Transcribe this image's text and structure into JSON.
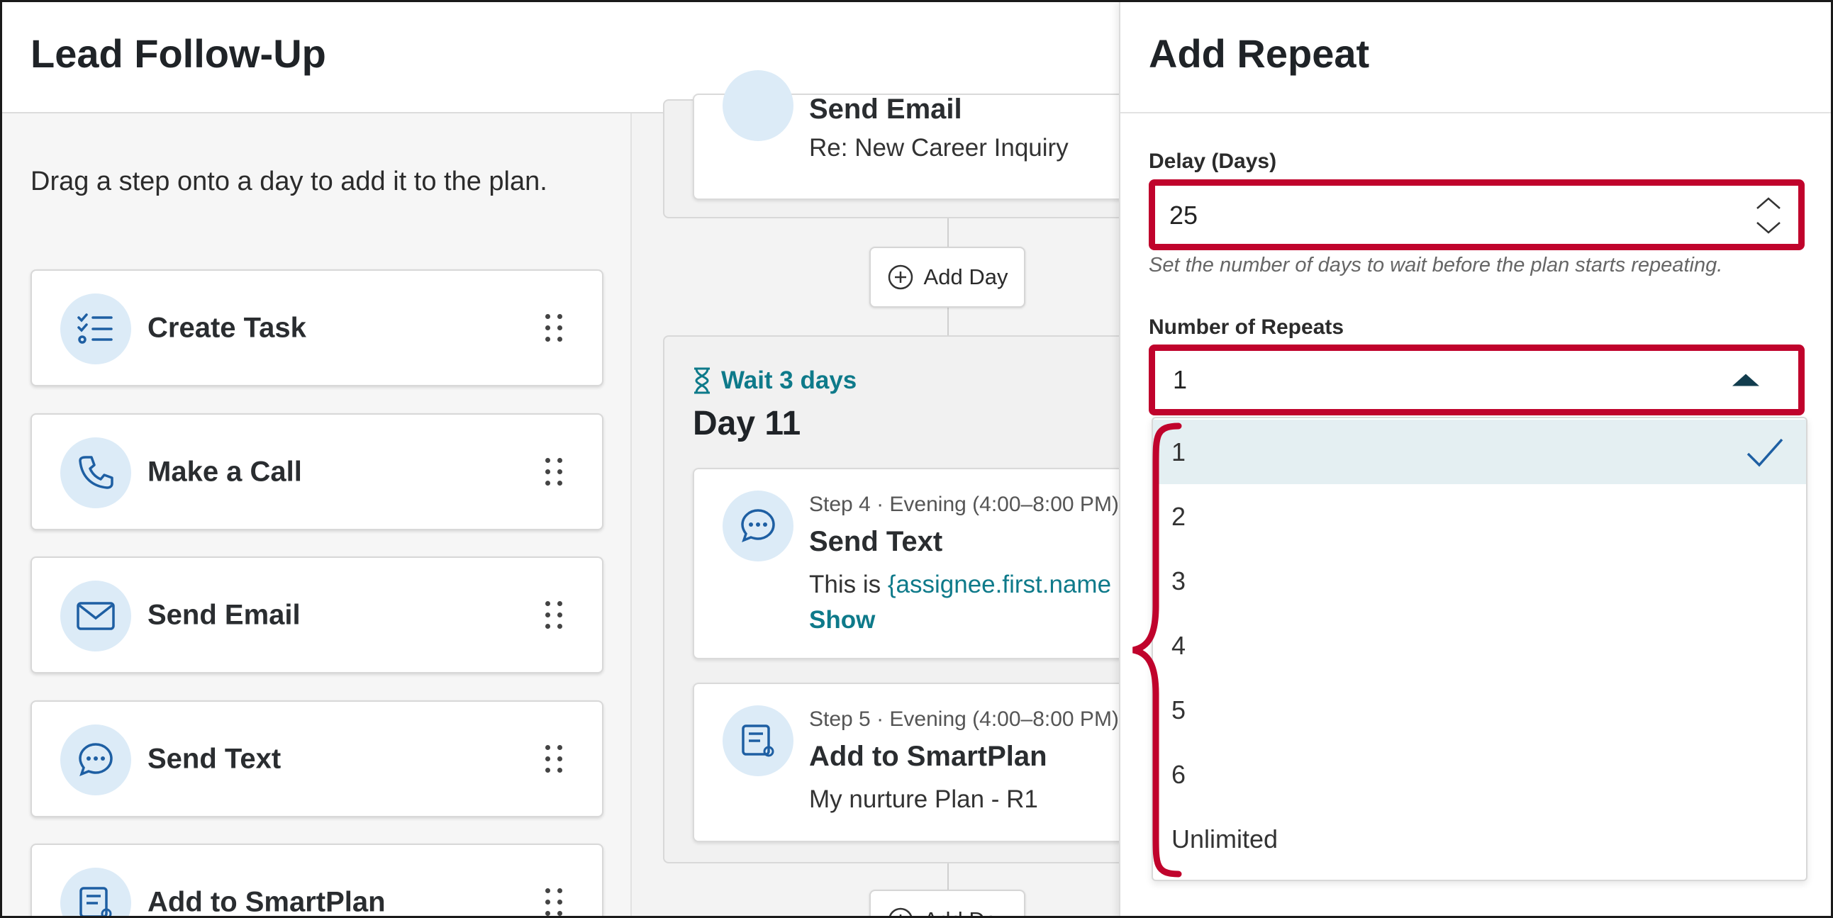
{
  "page": {
    "title": "Lead Follow-Up"
  },
  "palette": {
    "hint": "Drag a step onto a day to add it to the plan.",
    "steps": [
      {
        "label": "Create Task",
        "icon": "task-list-icon"
      },
      {
        "label": "Make a Call",
        "icon": "phone-icon"
      },
      {
        "label": "Send Email",
        "icon": "envelope-icon"
      },
      {
        "label": "Send Text",
        "icon": "chat-bubble-icon"
      },
      {
        "label": "Add to SmartPlan",
        "icon": "smartplan-icon"
      }
    ]
  },
  "timeline": {
    "top_card": {
      "title": "Send Email",
      "body": "Re: New Career Inquiry"
    },
    "add_day_label": "Add Day",
    "day": {
      "wait": "Wait 3 days",
      "title": "Day 11",
      "cards": [
        {
          "meta": "Step 4 · Evening (4:00–8:00 PM)",
          "title": "Send Text",
          "body_prefix": "This is ",
          "body_variable": "{assignee.first.name",
          "link": "Show"
        },
        {
          "meta": "Step 5 · Evening (4:00–8:00 PM)",
          "title": "Add to SmartPlan",
          "body": "My nurture Plan - R1"
        }
      ]
    }
  },
  "panel": {
    "title": "Add Repeat",
    "delay": {
      "label": "Delay (Days)",
      "value": "25",
      "help": "Set the number of days to wait before the plan starts repeating."
    },
    "repeats": {
      "label": "Number of Repeats",
      "selected": "1",
      "options": [
        "1",
        "2",
        "3",
        "4",
        "5",
        "6",
        "Unlimited"
      ]
    }
  },
  "colors": {
    "highlight": "#c0032c",
    "icon_blue": "#1e5fa3",
    "teal": "#0e7a8a",
    "selected_bg": "#e4eff2"
  }
}
